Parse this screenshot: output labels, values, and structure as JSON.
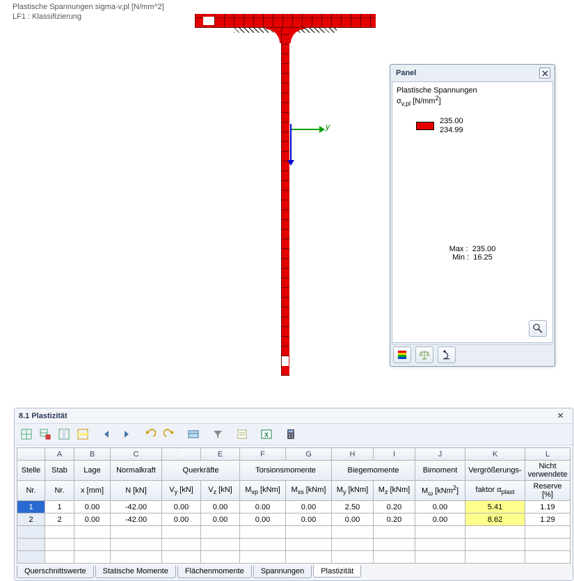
{
  "viewport": {
    "title_line1": "Plastische Spannungen sigma-v,pl [N/mm^2]",
    "title_line2": "LF1 : Klassifizierung",
    "axis_y_label": "y"
  },
  "panel": {
    "title": "Panel",
    "subtitle_line1": "Plastische Spannungen",
    "subtitle_line2_html": "σ<sub>v,pl</sub> [N/mm<sup>2</sup>]",
    "legend_hi": "235.00",
    "legend_lo": "234.99",
    "max_label": "Max  :",
    "max_value": "235.00",
    "min_label": "Min   :",
    "min_value": "16.25"
  },
  "table_panel": {
    "title": "8.1 Plastizität",
    "col_letters": [
      "",
      "A",
      "B",
      "C",
      "D",
      "E",
      "F",
      "G",
      "H",
      "I",
      "J",
      "K",
      "L"
    ],
    "selected_col_index": 4,
    "group_headers": [
      {
        "label": "Stelle",
        "span": 1
      },
      {
        "label": "Stab",
        "span": 1
      },
      {
        "label": "Lage",
        "span": 1
      },
      {
        "label": "Normalkraft",
        "span": 1
      },
      {
        "label": "Querkräfte",
        "span": 2
      },
      {
        "label": "Torsionsmomente",
        "span": 2
      },
      {
        "label": "Biegemomente",
        "span": 2
      },
      {
        "label": "Bimoment",
        "span": 1
      },
      {
        "label": "Vergrößerungs-",
        "span": 1
      },
      {
        "label": "Nicht verwendete",
        "span": 1
      }
    ],
    "sub_headers_html": [
      "Nr.",
      "Nr.",
      "x [mm]",
      "N [kN]",
      "V<sub>y</sub> [kN]",
      "V<sub>z</sub> [kN]",
      "M<sub>xp</sub> [kNm]",
      "M<sub>xs</sub> [kNm]",
      "M<sub>y</sub> [kNm]",
      "M<sub>z</sub> [kNm]",
      "M<sub>ω</sub> [kNm<sup>2</sup>]",
      "faktor α<sub>plast</sub>",
      "Reserve [%]"
    ],
    "rows": [
      {
        "sel": true,
        "cells": [
          "1",
          "1",
          "0.00",
          "-42.00",
          "0.00",
          "0.00",
          "0.00",
          "0.00",
          "2.50",
          "0.20",
          "0.00",
          "5.41",
          "1.19"
        ]
      },
      {
        "sel": false,
        "cells": [
          "2",
          "2",
          "0.00",
          "-42.00",
          "0.00",
          "0.00",
          "0.00",
          "0.00",
          "0.00",
          "0.20",
          "0.00",
          "8.62",
          "1.29"
        ]
      }
    ],
    "empty_rows": 3,
    "highlight_col_index": 11,
    "tabs": [
      "Querschnittswerte",
      "Statische Momente",
      "Flächenmomente",
      "Spannungen",
      "Plastizität"
    ],
    "active_tab_index": 4
  }
}
